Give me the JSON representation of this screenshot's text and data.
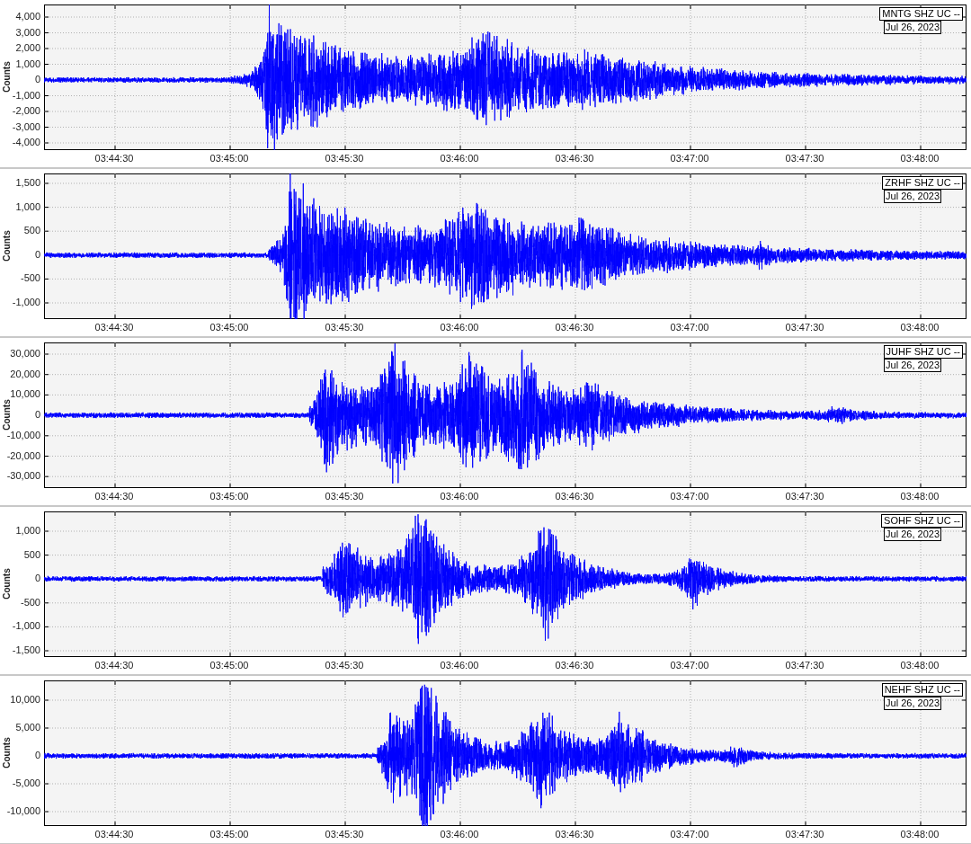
{
  "panels": [
    {
      "station": "MNTG SHZ UC --",
      "date": "Jul 26, 2023",
      "ylabel": "Counts",
      "yticks": [
        "4,000",
        "3,000",
        "2,000",
        "1,000",
        "0",
        "-1,000",
        "-2,000",
        "-3,000",
        "-4,000"
      ],
      "xticks": [
        "03:44:30",
        "03:45:00",
        "03:45:30",
        "03:46:00",
        "03:46:30",
        "03:47:00",
        "03:47:30",
        "03:48:00"
      ]
    },
    {
      "station": "ZRHF SHZ UC --",
      "date": "Jul 26, 2023",
      "ylabel": "Counts",
      "yticks": [
        "1,500",
        "1,000",
        "500",
        "0",
        "-500",
        "-1,000"
      ],
      "xticks": [
        "03:44:30",
        "03:45:00",
        "03:45:30",
        "03:46:00",
        "03:46:30",
        "03:47:00",
        "03:47:30",
        "03:48:00"
      ]
    },
    {
      "station": "JUHF SHZ UC --",
      "date": "Jul 26, 2023",
      "ylabel": "Counts",
      "yticks": [
        "30,000",
        "20,000",
        "10,000",
        "0",
        "-10,000",
        "-20,000",
        "-30,000"
      ],
      "xticks": [
        "03:44:30",
        "03:45:00",
        "03:45:30",
        "03:46:00",
        "03:46:30",
        "03:47:00",
        "03:47:30",
        "03:48:00"
      ]
    },
    {
      "station": "SOHF SHZ UC --",
      "date": "Jul 26, 2023",
      "ylabel": "Counts",
      "yticks": [
        "1,000",
        "500",
        "0",
        "-500",
        "-1,000",
        "-1,500"
      ],
      "xticks": [
        "03:44:30",
        "03:45:00",
        "03:45:30",
        "03:46:00",
        "03:46:30",
        "03:47:00",
        "03:47:30",
        "03:48:00"
      ]
    },
    {
      "station": "NEHF SHZ UC --",
      "date": "Jul 26, 2023",
      "ylabel": "Counts",
      "yticks": [
        "10,000",
        "5,000",
        "0",
        "-5,000",
        "-10,000"
      ],
      "xticks": [
        "03:44:30",
        "03:45:00",
        "03:45:30",
        "03:46:00",
        "03:46:30",
        "03:47:00",
        "03:47:30",
        "03:48:00"
      ]
    }
  ]
}
